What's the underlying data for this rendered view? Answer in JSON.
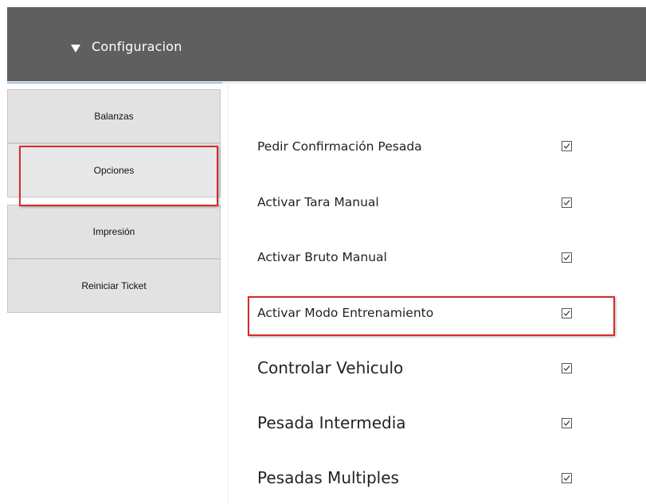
{
  "header": {
    "title": "Configuracion",
    "toggle_icon": "triangle-down-icon"
  },
  "sidebar": {
    "items": [
      {
        "label": "Balanzas"
      },
      {
        "label": "Opciones"
      },
      {
        "label": "Impresión"
      },
      {
        "label": "Reiniciar Ticket"
      }
    ]
  },
  "options": [
    {
      "label": "Pedir Confirmación Pesada",
      "checked": true
    },
    {
      "label": "Activar Tara Manual",
      "checked": true
    },
    {
      "label": "Activar Bruto Manual",
      "checked": true
    },
    {
      "label": "Activar Modo Entrenamiento",
      "checked": true
    },
    {
      "label": "Controlar Vehiculo",
      "checked": true
    },
    {
      "label": "Pesada Intermedia",
      "checked": true
    },
    {
      "label": "Pesadas Multiples",
      "checked": true
    }
  ],
  "colors": {
    "header_bg": "#5f5f5f",
    "highlight": "#d92b2b",
    "button_bg": "#e2e2e2"
  }
}
